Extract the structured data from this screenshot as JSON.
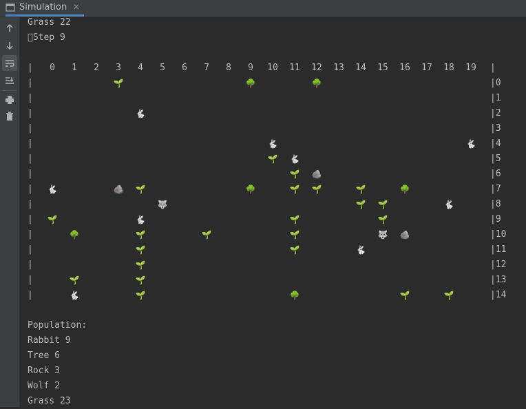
{
  "window": {
    "tab_title": "Simulation",
    "tab_icon": "console-window-icon",
    "tab_close": "×"
  },
  "toolbar": {
    "buttons": [
      {
        "name": "up-arrow-icon"
      },
      {
        "name": "down-arrow-icon"
      },
      {
        "name": "soft-wrap-icon",
        "active": true
      },
      {
        "name": "scroll-to-end-icon"
      },
      {
        "name": "print-icon"
      },
      {
        "name": "trash-icon"
      }
    ]
  },
  "console": {
    "top_lines": [
      "Grass 22",
      "\u0000Step 9"
    ],
    "column_headers": [
      "0",
      "1",
      "2",
      "3",
      "4",
      "5",
      "6",
      "7",
      "8",
      "9",
      "10",
      "11",
      "12",
      "13",
      "14",
      "15",
      "16",
      "17",
      "18",
      "19"
    ],
    "row_labels": [
      "0",
      "1",
      "2",
      "3",
      "4",
      "5",
      "6",
      "7",
      "8",
      "9",
      "10",
      "11",
      "12",
      "13",
      "14"
    ],
    "border_char": "|",
    "symbols": {
      "grass": "🌱",
      "tree": "🌳",
      "rabbit": "🐇",
      "wolf": "🐺",
      "rock": "🪨"
    },
    "grid": [
      {
        "row": 0,
        "col": 3,
        "type": "grass"
      },
      {
        "row": 0,
        "col": 9,
        "type": "tree"
      },
      {
        "row": 0,
        "col": 12,
        "type": "tree"
      },
      {
        "row": 2,
        "col": 4,
        "type": "rabbit"
      },
      {
        "row": 4,
        "col": 10,
        "type": "rabbit"
      },
      {
        "row": 4,
        "col": 19,
        "type": "rabbit"
      },
      {
        "row": 5,
        "col": 10,
        "type": "grass"
      },
      {
        "row": 5,
        "col": 11,
        "type": "rabbit"
      },
      {
        "row": 6,
        "col": 11,
        "type": "grass"
      },
      {
        "row": 6,
        "col": 12,
        "type": "rock"
      },
      {
        "row": 7,
        "col": 0,
        "type": "rabbit"
      },
      {
        "row": 7,
        "col": 3,
        "type": "rock"
      },
      {
        "row": 7,
        "col": 4,
        "type": "grass"
      },
      {
        "row": 7,
        "col": 9,
        "type": "tree"
      },
      {
        "row": 7,
        "col": 11,
        "type": "grass"
      },
      {
        "row": 7,
        "col": 12,
        "type": "grass"
      },
      {
        "row": 7,
        "col": 14,
        "type": "grass"
      },
      {
        "row": 7,
        "col": 16,
        "type": "tree"
      },
      {
        "row": 8,
        "col": 5,
        "type": "wolf"
      },
      {
        "row": 8,
        "col": 14,
        "type": "grass"
      },
      {
        "row": 8,
        "col": 15,
        "type": "grass"
      },
      {
        "row": 8,
        "col": 18,
        "type": "rabbit"
      },
      {
        "row": 9,
        "col": 0,
        "type": "grass"
      },
      {
        "row": 9,
        "col": 4,
        "type": "rabbit"
      },
      {
        "row": 9,
        "col": 11,
        "type": "grass"
      },
      {
        "row": 9,
        "col": 15,
        "type": "grass"
      },
      {
        "row": 10,
        "col": 1,
        "type": "tree"
      },
      {
        "row": 10,
        "col": 4,
        "type": "grass"
      },
      {
        "row": 10,
        "col": 7,
        "type": "grass"
      },
      {
        "row": 10,
        "col": 11,
        "type": "grass"
      },
      {
        "row": 10,
        "col": 15,
        "type": "wolf"
      },
      {
        "row": 10,
        "col": 16,
        "type": "rock"
      },
      {
        "row": 11,
        "col": 4,
        "type": "grass"
      },
      {
        "row": 11,
        "col": 11,
        "type": "grass"
      },
      {
        "row": 11,
        "col": 14,
        "type": "rabbit"
      },
      {
        "row": 12,
        "col": 4,
        "type": "grass"
      },
      {
        "row": 13,
        "col": 1,
        "type": "grass"
      },
      {
        "row": 13,
        "col": 4,
        "type": "grass"
      },
      {
        "row": 14,
        "col": 1,
        "type": "rabbit"
      },
      {
        "row": 14,
        "col": 4,
        "type": "grass"
      },
      {
        "row": 14,
        "col": 11,
        "type": "tree"
      },
      {
        "row": 14,
        "col": 16,
        "type": "grass"
      },
      {
        "row": 14,
        "col": 18,
        "type": "grass"
      }
    ],
    "population_title": "Population:",
    "population": [
      {
        "label": "Rabbit",
        "count": "9"
      },
      {
        "label": "Tree",
        "count": "6"
      },
      {
        "label": "Rock",
        "count": "3"
      },
      {
        "label": "Wolf",
        "count": "2"
      },
      {
        "label": "Grass",
        "count": "23"
      }
    ]
  }
}
